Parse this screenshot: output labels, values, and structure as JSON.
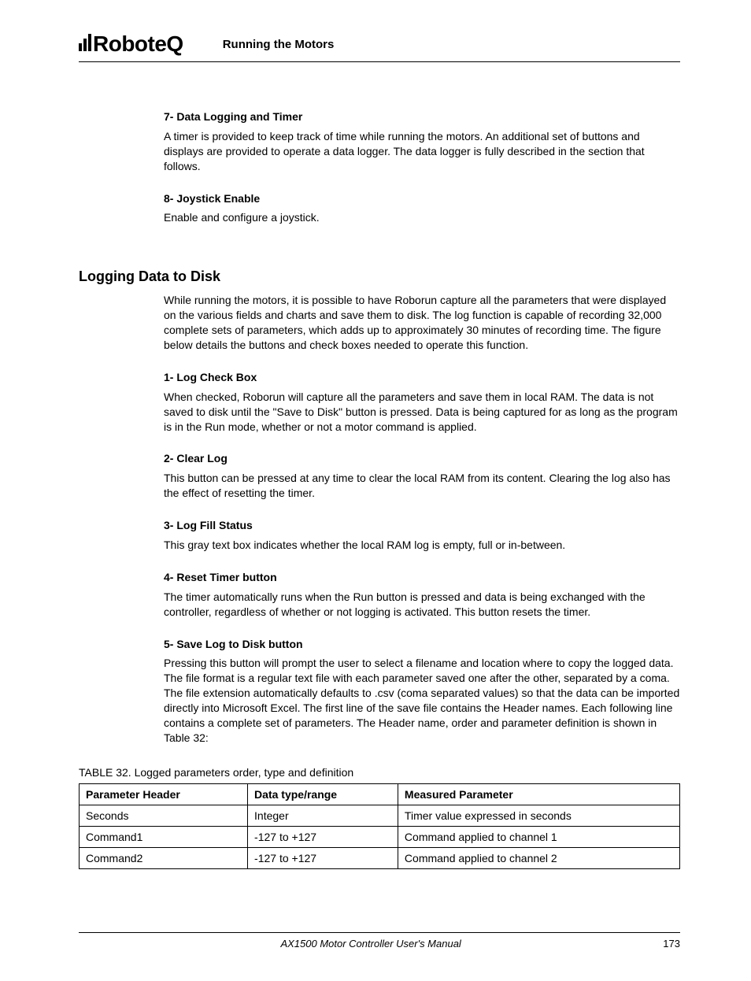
{
  "header": {
    "logo_text": "RoboteQ",
    "running_title": "Running the Motors"
  },
  "sections": {
    "s7": {
      "title": "7- Data Logging and Timer",
      "body": "A timer is provided to keep track of time while running the motors. An additional set of buttons and displays are provided to operate a data logger. The data logger is fully described in the section that follows."
    },
    "s8": {
      "title": "8- Joystick Enable",
      "body": "Enable and configure a joystick."
    },
    "logging": {
      "heading": "Logging Data to Disk",
      "intro": "While running the motors, it is possible to have Roborun capture all the parameters that were displayed on the various fields and charts and save them to disk. The log function is capable of recording 32,000 complete sets of parameters, which adds up to approximately 30 minutes of recording time. The figure below details the buttons and check boxes needed to operate this function."
    },
    "l1": {
      "title": "1- Log Check Box",
      "body": "When checked, Roborun will capture all the parameters and save them in local RAM. The data is not saved to disk until the \"Save to Disk\" button is pressed. Data is being captured for as long as the program is in the Run mode, whether or not a motor command is applied."
    },
    "l2": {
      "title": "2- Clear Log",
      "body": "This button can be pressed at any time to clear the local RAM from its content. Clearing the log also has the effect of resetting the timer."
    },
    "l3": {
      "title": "3- Log Fill Status",
      "body": "This gray text box indicates whether the local RAM log is empty, full or in-between."
    },
    "l4": {
      "title": "4- Reset Timer button",
      "body": "The timer automatically runs when the Run button is pressed and data is being exchanged with the controller, regardless of whether or not logging is activated. This button resets the timer."
    },
    "l5": {
      "title": "5- Save Log to Disk button",
      "body": "Pressing this button will prompt the user to select a filename and location where to copy the logged data. The file format is a regular text file with each parameter saved one after the other, separated by a coma. The file extension automatically defaults to .csv (coma separated values) so that the data can be imported directly into Microsoft Excel. The first line of the save file contains the Header names. Each following line contains a complete set of parameters. The Header name, order and parameter definition is shown in Table 32:"
    }
  },
  "table": {
    "caption_prefix": "TABLE 32. ",
    "caption": "Logged parameters order, type and definition",
    "headers": {
      "c1": "Parameter Header",
      "c2": "Data type/range",
      "c3": "Measured Parameter"
    },
    "rows": [
      {
        "c1": "Seconds",
        "c2": "Integer",
        "c3": "Timer value expressed in seconds"
      },
      {
        "c1": "Command1",
        "c2": "-127 to +127",
        "c3": "Command applied to channel 1"
      },
      {
        "c1": "Command2",
        "c2": "-127 to +127",
        "c3": "Command applied to channel 2"
      }
    ]
  },
  "footer": {
    "manual": "AX1500 Motor Controller User's Manual",
    "page": "173"
  }
}
